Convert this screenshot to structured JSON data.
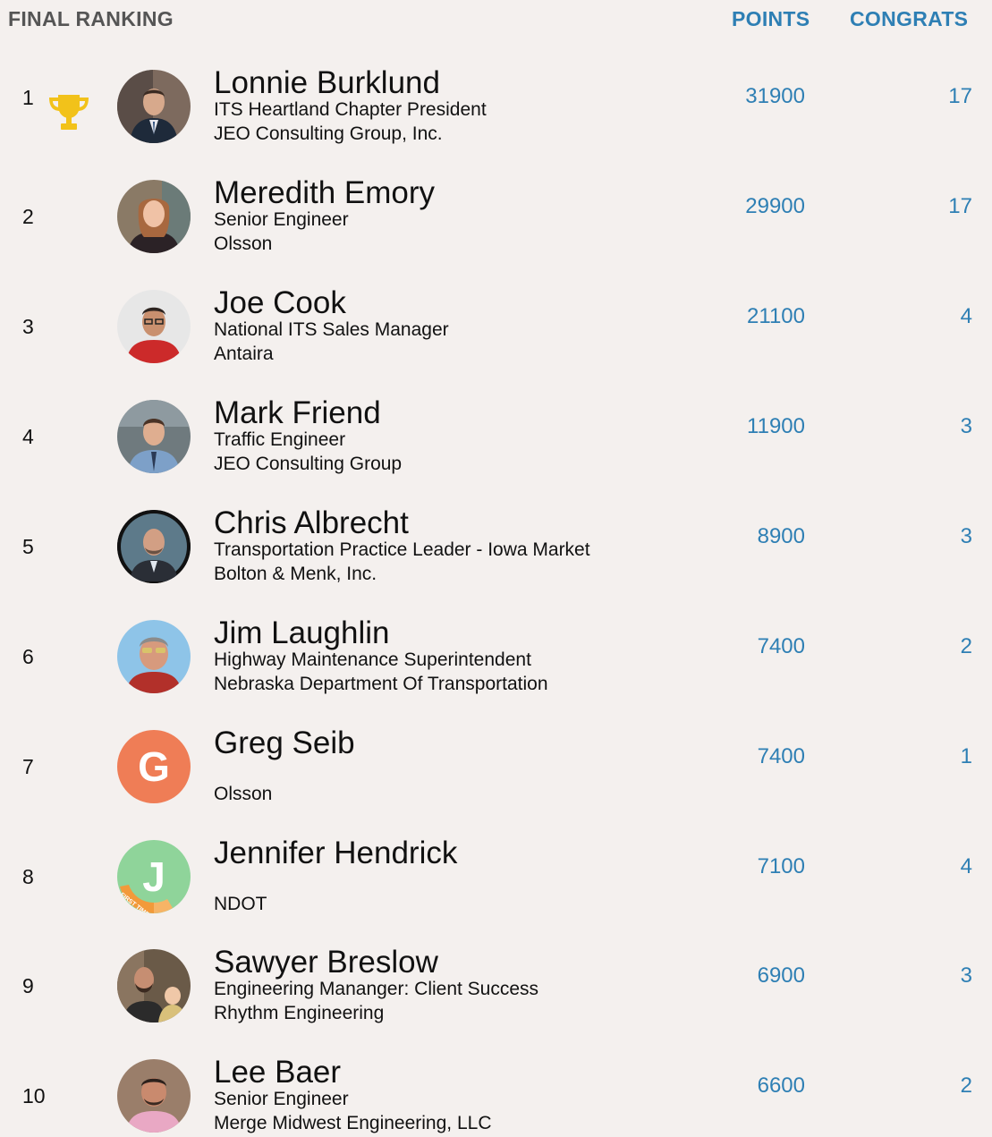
{
  "header": {
    "title": "FINAL RANKING",
    "points_label": "POINTS",
    "congrats_label": "CONGRATS"
  },
  "colors": {
    "accent": "#2e7fb4",
    "background": "#f4f0ee",
    "trophy": "#f2c21a"
  },
  "rows": [
    {
      "rank": "1",
      "name": "Lonnie Burklund",
      "title": "ITS Heartland Chapter President",
      "org": "JEO Consulting Group, Inc.",
      "points": "31900",
      "congrats": "17",
      "avatar_icon": "photo-avatar-icon"
    },
    {
      "rank": "2",
      "name": "Meredith Emory",
      "title": "Senior Engineer",
      "org": "Olsson",
      "points": "29900",
      "congrats": "17",
      "avatar_icon": "photo-avatar-icon"
    },
    {
      "rank": "3",
      "name": "Joe Cook",
      "title": "National ITS Sales Manager",
      "org": "Antaira",
      "points": "21100",
      "congrats": "4",
      "avatar_icon": "photo-avatar-icon"
    },
    {
      "rank": "4",
      "name": "Mark Friend",
      "title": "Traffic Engineer",
      "org": "JEO Consulting Group",
      "points": "11900",
      "congrats": "3",
      "avatar_icon": "photo-avatar-icon"
    },
    {
      "rank": "5",
      "name": "Chris Albrecht",
      "title": "Transportation Practice Leader - Iowa Market",
      "org": "Bolton & Menk, Inc.",
      "points": "8900",
      "congrats": "3",
      "avatar_icon": "photo-avatar-icon"
    },
    {
      "rank": "6",
      "name": "Jim Laughlin",
      "title": "Highway Maintenance Superintendent",
      "org": "Nebraska Department Of Transportation",
      "points": "7400",
      "congrats": "2",
      "avatar_icon": "photo-avatar-icon"
    },
    {
      "rank": "7",
      "name": "Greg Seib",
      "title": "",
      "org": "Olsson",
      "points": "7400",
      "congrats": "1",
      "avatar_icon": "initial-avatar-icon",
      "avatar_initial": "G",
      "avatar_color": "#ef7d56"
    },
    {
      "rank": "8",
      "name": "Jennifer Hendrick",
      "title": "",
      "org": "NDOT",
      "points": "7100",
      "congrats": "4",
      "avatar_icon": "initial-avatar-icon",
      "avatar_initial": "J",
      "avatar_color": "#8fd49a",
      "avatar_badge": "FIRST TIMER"
    },
    {
      "rank": "9",
      "name": "Sawyer Breslow",
      "title": "Engineering Mananger: Client Success",
      "org": "Rhythm Engineering",
      "points": "6900",
      "congrats": "3",
      "avatar_icon": "photo-avatar-icon"
    },
    {
      "rank": "10",
      "name": "Lee Baer",
      "title": "Senior Engineer",
      "org": "Merge Midwest Engineering, LLC",
      "points": "6600",
      "congrats": "2",
      "avatar_icon": "photo-avatar-icon"
    }
  ]
}
